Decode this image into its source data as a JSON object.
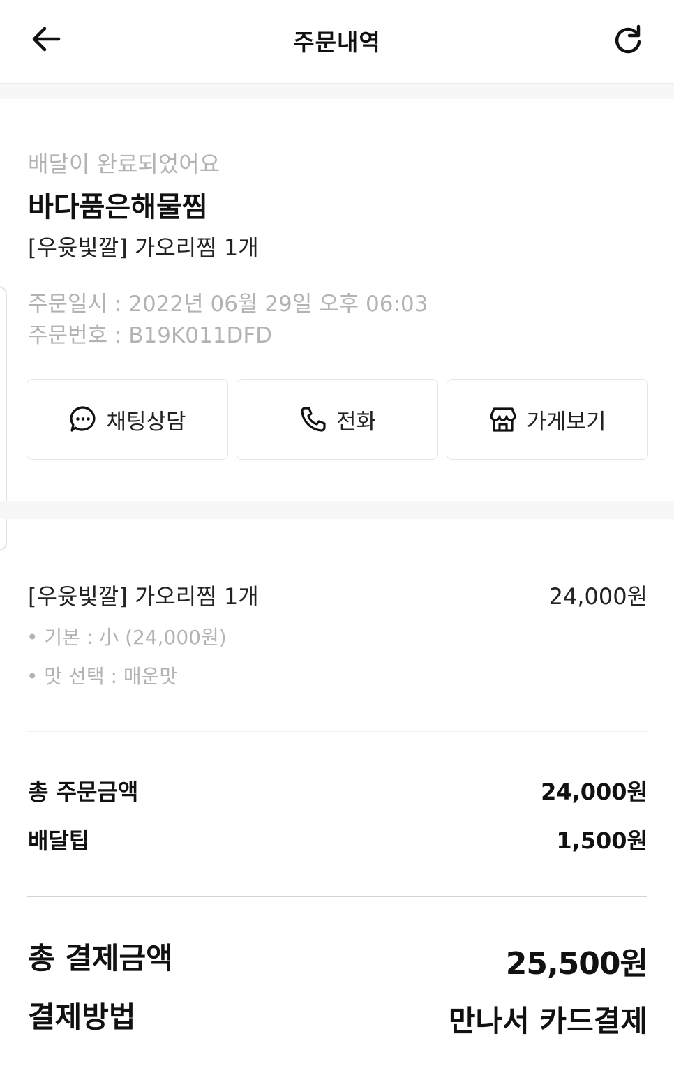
{
  "header": {
    "title": "주문내역",
    "back_icon": "arrow-left-icon",
    "refresh_icon": "refresh-icon"
  },
  "order": {
    "status": "배달이 완료되었어요",
    "store_name": "바다품은해물찜",
    "menu_summary": "[우윳빛깔] 가오리찜 1개",
    "order_date": "주문일시 : 2022년 06월 29일 오후 06:03",
    "order_number": "주문번호 : B19K011DFD"
  },
  "actions": {
    "chat_label": "채팅상담",
    "call_label": "전화",
    "store_label": "가게보기"
  },
  "items": [
    {
      "name": "[우윳빛깔] 가오리찜 1개",
      "price": "24,000원",
      "options": [
        "• 기본 : 小 (24,000원)",
        "• 맛 선택 : 매운맛"
      ]
    }
  ],
  "summary": {
    "order_total_label": "총 주문금액",
    "order_total_value": "24,000원",
    "delivery_tip_label": "배달팁",
    "delivery_tip_value": "1,500원",
    "payment_total_label": "총 결제금액",
    "payment_total_value": "25,500원",
    "payment_method_label": "결제방법",
    "payment_method_value": "만나서 카드결제"
  },
  "colors": {
    "text": "#111111",
    "muted": "#b3b3b3",
    "border": "#e6e6e6",
    "band": "#f7f7f7"
  }
}
